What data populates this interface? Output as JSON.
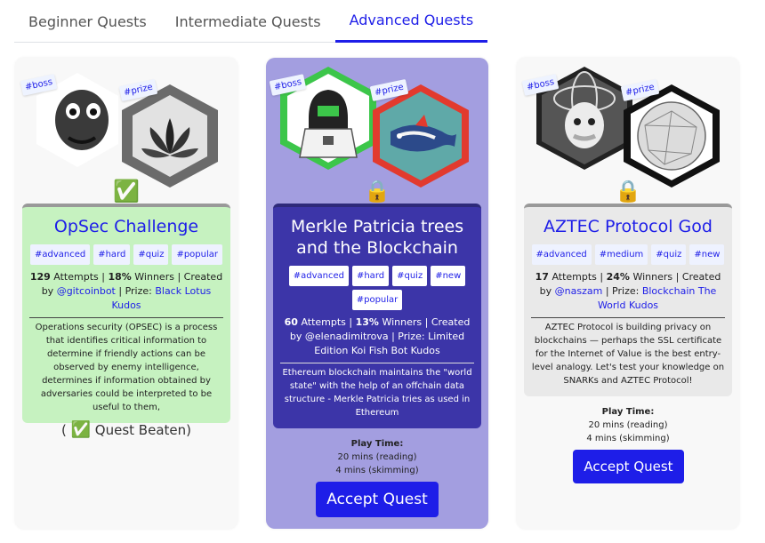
{
  "tabs": [
    {
      "label": "Beginner Quests"
    },
    {
      "label": "Intermediate Quests"
    },
    {
      "label": "Advanced Quests",
      "active": true
    }
  ],
  "cards": [
    {
      "float_tags": [
        "#boss",
        "#prize"
      ],
      "status_icon": "check-mark-icon",
      "status_glyph": "✅",
      "title": "OpSec Challenge",
      "tags": [
        "#advanced",
        "#hard",
        "#quiz",
        "#popular"
      ],
      "attempts": "129",
      "attempts_label": " Attempts | ",
      "winners_pct": "18%",
      "winners_label": " Winners | Created by ",
      "creator": "@gitcoinbot",
      "prize_label": " | Prize: ",
      "prize": "Black Lotus Kudos",
      "description": "Operations security (OPSEC) is a process that identifies critical information to determine if friendly actions can be observed by enemy intelligence, determines if information obtained by adversaries could be interpreted to be useful to them,",
      "beaten_prefix": "( ",
      "beaten_glyph": "✅",
      "beaten_text": " Quest Beaten)"
    },
    {
      "float_tags": [
        "#boss",
        "#prize"
      ],
      "status_icon": "lock-icon",
      "status_glyph": "🔒",
      "title": "Merkle Patricia trees and the Blockchain",
      "tags": [
        "#advanced",
        "#hard",
        "#quiz",
        "#new",
        "#popular"
      ],
      "attempts": "60",
      "attempts_label": " Attempts | ",
      "winners_pct": "13%",
      "winners_label": " Winners | Created by ",
      "creator": "@elenadimitrova",
      "prize_label": " | Prize: ",
      "prize": "Limited Edition Koi Fish Bot Kudos",
      "description": "Ethereum blockchain maintains the \"world state\" with the help of an offchain data structure - Merkle Patricia tries as used in Ethereum",
      "play_time_label": "Play Time:",
      "play_time_reading": "20 mins (reading)",
      "play_time_skimming": "4 mins (skimming)",
      "accept_label": "Accept Quest"
    },
    {
      "float_tags": [
        "#boss",
        "#prize"
      ],
      "status_icon": "lock-icon",
      "status_glyph": "🔒",
      "title": "AZTEC Protocol God",
      "tags": [
        "#advanced",
        "#medium",
        "#quiz",
        "#new"
      ],
      "attempts": "17",
      "attempts_label": " Attempts | ",
      "winners_pct": "24%",
      "winners_label": " Winners | Created by ",
      "creator": "@naszam",
      "prize_label": " | Prize: ",
      "prize": "Blockchain The World Kudos",
      "description": "AZTEC Protocol is building privacy on blockchains — perhaps the SSL certificate for the Internet of Value is the best entry-level analogy. Let's test your knowledge on SNARKs and AZTEC Protocol!",
      "play_time_label": "Play Time:",
      "play_time_reading": "20 mins (reading)",
      "play_time_skimming": "4 mins (skimming)",
      "accept_label": "Accept Quest"
    }
  ],
  "colors": {
    "accent": "#1e1ee8",
    "card2_bg": "#a39ee0",
    "card2_panel": "#3c35a8",
    "card1_panel": "#c6f2c0"
  }
}
